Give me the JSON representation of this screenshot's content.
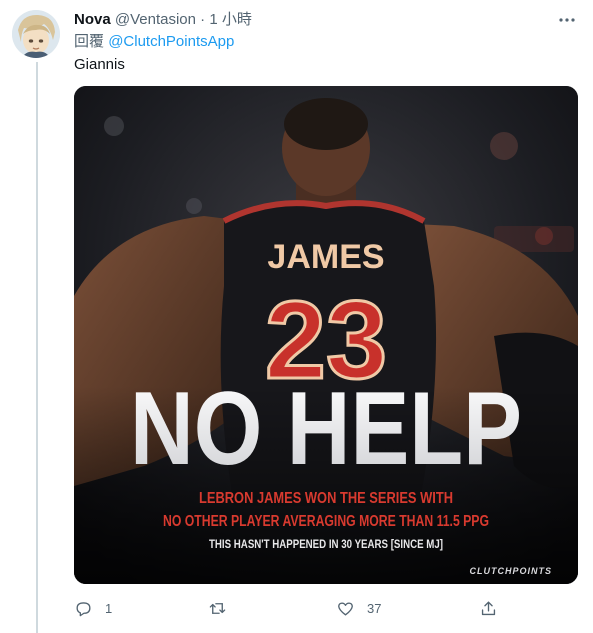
{
  "tweet": {
    "name": "Nova",
    "handle": "@Ventasion",
    "separator": "·",
    "time": "1 小時",
    "reply_prefix": "回覆",
    "reply_to": "@ClutchPointsApp",
    "text": "Giannis"
  },
  "media": {
    "jersey_name": "JAMES",
    "jersey_number": "23",
    "headline": "NO HELP",
    "subline_1": "LEBRON JAMES WON THE SERIES WITH",
    "subline_2": "NO OTHER PLAYER AVERAGING MORE THAN 11.5 PPG",
    "subline_3": "THIS HASN'T HAPPENED IN 30 YEARS [SINCE MJ]",
    "brand": "CLUTCHPOINTS"
  },
  "actions": {
    "reply_count": "1",
    "retweet_count": "",
    "like_count": "37"
  },
  "colors": {
    "accent": "#1d9bf0",
    "muted": "#536471",
    "jersey_red": "#c8312b"
  },
  "icons": [
    "avatar",
    "more-icon",
    "reply-icon",
    "retweet-icon",
    "like-icon",
    "share-icon"
  ]
}
